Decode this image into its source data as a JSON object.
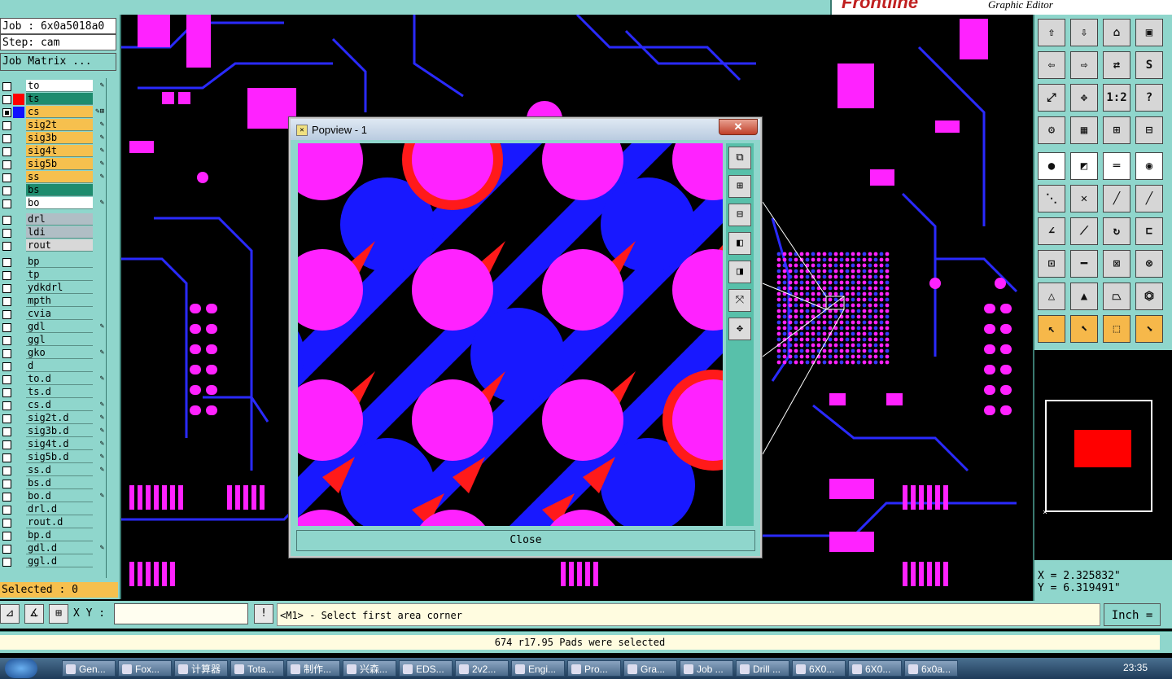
{
  "brand": {
    "logo": "Frontline",
    "subtitle": "Graphic Editor"
  },
  "job": {
    "job_label": "Job : 6x0a5018a0",
    "step_label": "Step: cam",
    "matrix_button": "Job Matrix ..."
  },
  "layers": [
    {
      "name": "to",
      "bg": "#ffffff",
      "swatch": "",
      "checked": false,
      "flag": "✎"
    },
    {
      "name": "ts",
      "bg": "#1e8c6e",
      "swatch": "#ff0000",
      "checked": false,
      "flag": ""
    },
    {
      "name": "cs",
      "bg": "#f6c04e",
      "swatch": "#1010ff",
      "checked": true,
      "flag": "✎⊞"
    },
    {
      "name": "sig2t",
      "bg": "#f6c04e",
      "swatch": "",
      "checked": false,
      "flag": "✎"
    },
    {
      "name": "sig3b",
      "bg": "#f6c04e",
      "swatch": "",
      "checked": false,
      "flag": "✎"
    },
    {
      "name": "sig4t",
      "bg": "#f6c04e",
      "swatch": "",
      "checked": false,
      "flag": "✎"
    },
    {
      "name": "sig5b",
      "bg": "#f6c04e",
      "swatch": "",
      "checked": false,
      "flag": "✎"
    },
    {
      "name": "ss",
      "bg": "#f6c04e",
      "swatch": "",
      "checked": false,
      "flag": "✎"
    },
    {
      "name": "bs",
      "bg": "#1e8c6e",
      "swatch": "",
      "checked": false,
      "flag": ""
    },
    {
      "name": "bo",
      "bg": "#ffffff",
      "swatch": "",
      "checked": false,
      "flag": "✎"
    },
    {
      "name": "drl",
      "bg": "#b0bec5",
      "swatch": "",
      "checked": false,
      "flag": "",
      "gap": true
    },
    {
      "name": "ldi",
      "bg": "#b0bec5",
      "swatch": "",
      "checked": false,
      "flag": ""
    },
    {
      "name": "rout",
      "bg": "#d8d8d8",
      "swatch": "",
      "checked": false,
      "flag": ""
    },
    {
      "name": "bp",
      "bg": "#8fd6cc",
      "swatch": "",
      "checked": false,
      "flag": "",
      "gap": true
    },
    {
      "name": "tp",
      "bg": "#8fd6cc",
      "swatch": "",
      "checked": false,
      "flag": ""
    },
    {
      "name": "ydkdrl",
      "bg": "#8fd6cc",
      "swatch": "",
      "checked": false,
      "flag": ""
    },
    {
      "name": "mpth",
      "bg": "#8fd6cc",
      "swatch": "",
      "checked": false,
      "flag": ""
    },
    {
      "name": "cvia",
      "bg": "#8fd6cc",
      "swatch": "",
      "checked": false,
      "flag": ""
    },
    {
      "name": "gdl",
      "bg": "#8fd6cc",
      "swatch": "",
      "checked": false,
      "flag": "✎"
    },
    {
      "name": "ggl",
      "bg": "#8fd6cc",
      "swatch": "",
      "checked": false,
      "flag": ""
    },
    {
      "name": "gko",
      "bg": "#8fd6cc",
      "swatch": "",
      "checked": false,
      "flag": "✎"
    },
    {
      "name": "d",
      "bg": "#8fd6cc",
      "swatch": "",
      "checked": false,
      "flag": ""
    },
    {
      "name": "to.d",
      "bg": "#8fd6cc",
      "swatch": "",
      "checked": false,
      "flag": "✎"
    },
    {
      "name": "ts.d",
      "bg": "#8fd6cc",
      "swatch": "",
      "checked": false,
      "flag": ""
    },
    {
      "name": "cs.d",
      "bg": "#8fd6cc",
      "swatch": "",
      "checked": false,
      "flag": "✎"
    },
    {
      "name": "sig2t.d",
      "bg": "#8fd6cc",
      "swatch": "",
      "checked": false,
      "flag": "✎"
    },
    {
      "name": "sig3b.d",
      "bg": "#8fd6cc",
      "swatch": "",
      "checked": false,
      "flag": "✎"
    },
    {
      "name": "sig4t.d",
      "bg": "#8fd6cc",
      "swatch": "",
      "checked": false,
      "flag": "✎"
    },
    {
      "name": "sig5b.d",
      "bg": "#8fd6cc",
      "swatch": "",
      "checked": false,
      "flag": "✎"
    },
    {
      "name": "ss.d",
      "bg": "#8fd6cc",
      "swatch": "",
      "checked": false,
      "flag": "✎"
    },
    {
      "name": "bs.d",
      "bg": "#8fd6cc",
      "swatch": "",
      "checked": false,
      "flag": ""
    },
    {
      "name": "bo.d",
      "bg": "#8fd6cc",
      "swatch": "",
      "checked": false,
      "flag": "✎"
    },
    {
      "name": "drl.d",
      "bg": "#8fd6cc",
      "swatch": "",
      "checked": false,
      "flag": ""
    },
    {
      "name": "rout.d",
      "bg": "#8fd6cc",
      "swatch": "",
      "checked": false,
      "flag": ""
    },
    {
      "name": "bp.d",
      "bg": "#8fd6cc",
      "swatch": "",
      "checked": false,
      "flag": ""
    },
    {
      "name": "gdl.d",
      "bg": "#8fd6cc",
      "swatch": "",
      "checked": false,
      "flag": "✎"
    },
    {
      "name": "ggl.d",
      "bg": "#8fd6cc",
      "swatch": "",
      "checked": false,
      "flag": ""
    }
  ],
  "selected_label": "Selected : 0",
  "popup": {
    "title": "Popview - 1",
    "close_x": "✕",
    "close_button": "Close",
    "side_buttons": [
      "zoom-fit-icon",
      "zoom-in-icon",
      "zoom-out-icon",
      "pan-left-icon",
      "pan-right-icon",
      "zoom-extents-icon",
      "pan-all-icon"
    ]
  },
  "toolbar": [
    {
      "icon": "home-up-icon",
      "glyph": "⇧",
      "style": "g"
    },
    {
      "icon": "down-icon",
      "glyph": "⇩",
      "style": "g"
    },
    {
      "icon": "home-icon",
      "glyph": "⌂",
      "style": "g"
    },
    {
      "icon": "frame-icon",
      "glyph": "▣",
      "style": "g"
    },
    {
      "icon": "left-icon",
      "glyph": "⇦",
      "style": "g"
    },
    {
      "icon": "right-icon",
      "glyph": "⇨",
      "style": "g"
    },
    {
      "icon": "swap-icon",
      "glyph": "⇄",
      "style": "g"
    },
    {
      "icon": "redraw-icon",
      "glyph": "S",
      "style": "g"
    },
    {
      "icon": "fit-icon",
      "glyph": "⤢",
      "style": "g"
    },
    {
      "icon": "center-icon",
      "glyph": "✥",
      "style": "g"
    },
    {
      "icon": "scale-icon",
      "glyph": "1:2",
      "style": "g"
    },
    {
      "icon": "help-icon",
      "glyph": "?",
      "style": "g"
    },
    {
      "icon": "snap-icon",
      "glyph": "⚙",
      "style": "g"
    },
    {
      "icon": "grid-icon",
      "glyph": "▦",
      "style": "g"
    },
    {
      "icon": "net-a-icon",
      "glyph": "⊞",
      "style": "g"
    },
    {
      "icon": "net-b-icon",
      "glyph": "⊟",
      "style": "g"
    },
    {
      "icon": "pad-icon",
      "glyph": "●",
      "style": "w"
    },
    {
      "icon": "measure-icon",
      "glyph": "◩",
      "style": "w"
    },
    {
      "icon": "ruler-icon",
      "glyph": "═",
      "style": "w"
    },
    {
      "icon": "circle-icon",
      "glyph": "◉",
      "style": "w"
    },
    {
      "icon": "node-icon",
      "glyph": "⋱",
      "style": "g"
    },
    {
      "icon": "cross-icon",
      "glyph": "✕",
      "style": "g"
    },
    {
      "icon": "line-a-icon",
      "glyph": "╱",
      "style": "g"
    },
    {
      "icon": "line-b-icon",
      "glyph": "╱",
      "style": "g"
    },
    {
      "icon": "angle-icon",
      "glyph": "∠",
      "style": "g"
    },
    {
      "icon": "diag-icon",
      "glyph": "⟋",
      "style": "g"
    },
    {
      "icon": "arc-icon",
      "glyph": "↻",
      "style": "g"
    },
    {
      "icon": "fork-icon",
      "glyph": "⊏",
      "style": "g"
    },
    {
      "icon": "point-icon",
      "glyph": "⊡",
      "style": "g"
    },
    {
      "icon": "hline-icon",
      "glyph": "━",
      "style": "g"
    },
    {
      "icon": "dim-icon",
      "glyph": "⊠",
      "style": "g"
    },
    {
      "icon": "multi-icon",
      "glyph": "⊗",
      "style": "g"
    },
    {
      "icon": "tri-a-icon",
      "glyph": "△",
      "style": "g"
    },
    {
      "icon": "tri-b-icon",
      "glyph": "▲",
      "style": "g"
    },
    {
      "icon": "tri-c-icon",
      "glyph": "⏢",
      "style": "g"
    },
    {
      "icon": "tri-d-icon",
      "glyph": "⏣",
      "style": "g"
    },
    {
      "icon": "pointer-icon",
      "glyph": "↖",
      "style": "y"
    },
    {
      "icon": "select-icon",
      "glyph": "⬉",
      "style": "y"
    },
    {
      "icon": "select-box-icon",
      "glyph": "⬚",
      "style": "y"
    },
    {
      "icon": "select-net-icon",
      "glyph": "⬊",
      "style": "y"
    }
  ],
  "coords": {
    "x": "X = 2.325832\"",
    "y": "Y = 6.319491\""
  },
  "cmd": {
    "xy_label": "X Y :",
    "xy_value": "",
    "prompt": "<M1> - Select first area corner",
    "units": "Inch ="
  },
  "status": "674 r17.95 Pads were selected",
  "taskbar": {
    "items": [
      "Gen...",
      "Fox...",
      "计算器",
      "Tota...",
      "制作...",
      "兴森...",
      "EDS...",
      "2v2...",
      "Engi...",
      "Pro...",
      "Gra...",
      "Job ...",
      "Drill ...",
      "6X0...",
      "6X0...",
      "6x0a..."
    ],
    "clock": "23:35"
  }
}
